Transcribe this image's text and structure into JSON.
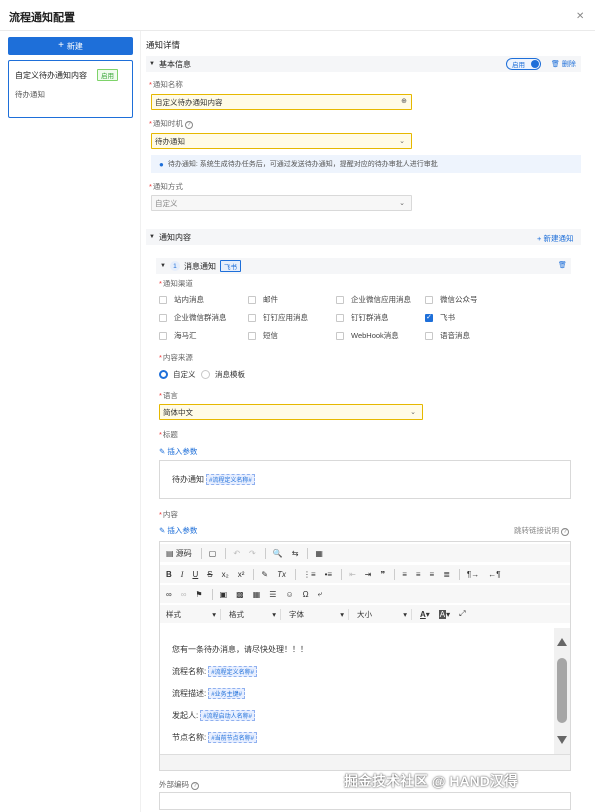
{
  "dialog": {
    "title": "流程通知配置"
  },
  "sidebar": {
    "new_label": "新建",
    "item": {
      "title": "自定义待办通知内容",
      "badge": "启用",
      "sub": "待办通知"
    }
  },
  "main": {
    "section_title": "通知详情",
    "basic": {
      "title": "基本信息",
      "toggle_label": "启用",
      "delete_label": "删除",
      "name_label": "通知名称",
      "name_value": "自定义待办通知内容",
      "timing_label": "通知时机",
      "timing_value": "待办通知",
      "tip_text": "待办通知: 系统生成待办任务后，可通过发送待办通知，提醒对应的待办审批人进行审批",
      "method_label": "通知方式",
      "method_value": "自定义"
    },
    "content": {
      "title": "通知内容",
      "new_label": "新建通知",
      "item_num": "1",
      "item_title": "消息通知",
      "item_tag": "飞书",
      "channel_label": "通知渠道",
      "channels": [
        [
          "站内消息",
          "邮件",
          "企业微信应用消息",
          "微信公众号"
        ],
        [
          "企业微信群消息",
          "钉钉应用消息",
          "钉钉群消息",
          "飞书"
        ],
        [
          "海马汇",
          "短信",
          "WebHook消息",
          "语音消息"
        ]
      ],
      "source_label": "内容来源",
      "source_options": [
        "自定义",
        "消息模板"
      ],
      "lang_label": "语言",
      "lang_value": "简体中文",
      "title_label": "标题",
      "insert_param": "插入参数",
      "title_text": "待办通知",
      "title_chip": "#流程定义名称#",
      "body_label": "内容",
      "jump_link": "跳转链接说明",
      "toolbar": {
        "source": "源码",
        "fmt_style": "样式",
        "fmt_format": "格式",
        "fmt_font": "字体",
        "fmt_size": "大小"
      },
      "body_lines": [
        {
          "text": "您有一条待办消息，请尽快处理！！！",
          "chip": ""
        },
        {
          "text": "流程名称:",
          "chip": "#流程定义名称#"
        },
        {
          "text": "流程描述:",
          "chip": "#业务主键#"
        },
        {
          "text": "发起人:",
          "chip": "#流程启动人名称#"
        },
        {
          "text": "节点名称:",
          "chip": "#当前节点名称#"
        }
      ],
      "outer_code_label": "外部编码"
    }
  },
  "watermark": "掘金技术社区 @ HAND汉得",
  "colors": {
    "accent": "#1e6fd9",
    "highlight": "#e6b800"
  }
}
